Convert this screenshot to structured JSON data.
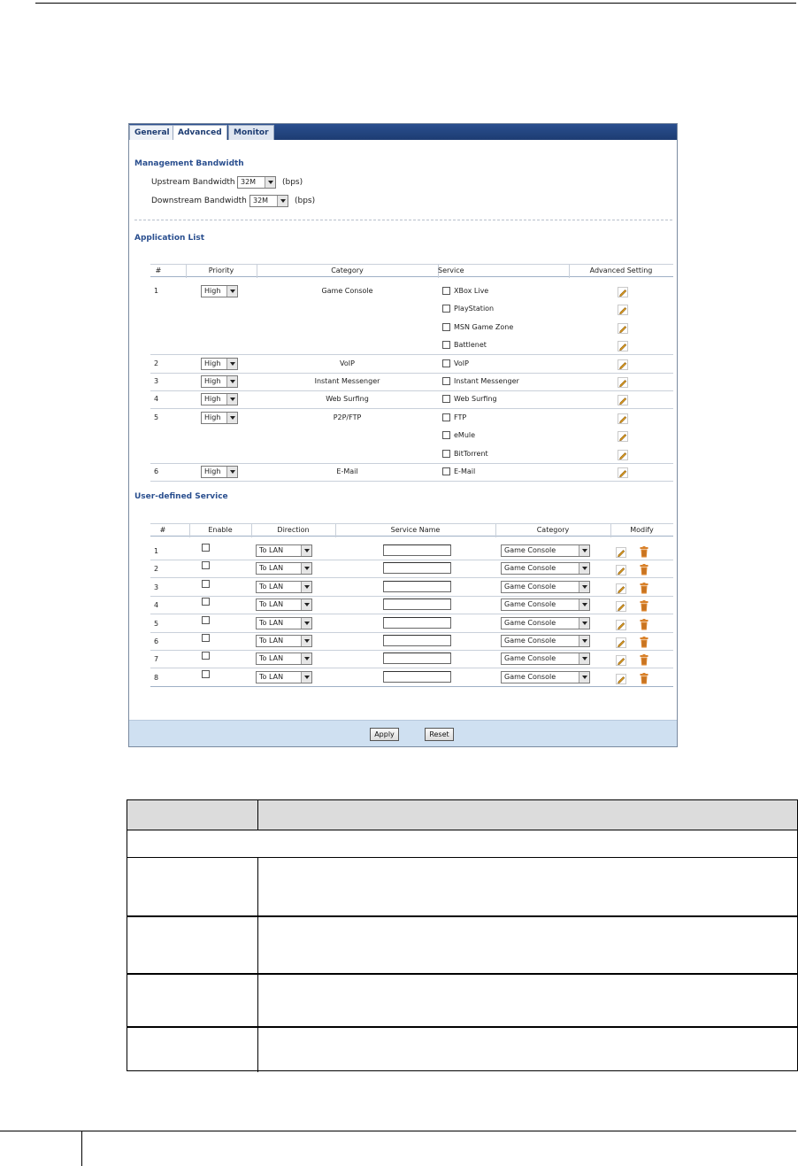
{
  "tabs": [
    {
      "label": "General"
    },
    {
      "label": "Advanced"
    },
    {
      "label": "Monitor"
    }
  ],
  "management": {
    "title": "Management Bandwidth",
    "upstream_label": "Upstream Bandwidth",
    "upstream_value": "32M",
    "upstream_unit": "(bps)",
    "downstream_label": "Downstream Bandwidth",
    "downstream_value": "32M",
    "downstream_unit": "(bps)"
  },
  "application_list": {
    "title": "Application List",
    "columns": [
      "#",
      "Priority",
      "Category",
      "Service",
      "Advanced Setting"
    ],
    "rows": [
      {
        "num": "1",
        "priority": "High",
        "category": "Game Console",
        "service": "XBox Live"
      },
      {
        "num": "",
        "priority": "",
        "category": "",
        "service": "PlayStation"
      },
      {
        "num": "",
        "priority": "",
        "category": "",
        "service": "MSN Game Zone"
      },
      {
        "num": "",
        "priority": "",
        "category": "",
        "service": "Battlenet"
      },
      {
        "num": "2",
        "priority": "High",
        "category": "VoIP",
        "service": "VoIP"
      },
      {
        "num": "3",
        "priority": "High",
        "category": "Instant Messenger",
        "service": "Instant Messenger"
      },
      {
        "num": "4",
        "priority": "High",
        "category": "Web Surfing",
        "service": "Web Surfing"
      },
      {
        "num": "5",
        "priority": "High",
        "category": "P2P/FTP",
        "service": "FTP"
      },
      {
        "num": "",
        "priority": "",
        "category": "",
        "service": "eMule"
      },
      {
        "num": "",
        "priority": "",
        "category": "",
        "service": "BitTorrent"
      },
      {
        "num": "6",
        "priority": "High",
        "category": "E-Mail",
        "service": "E-Mail"
      }
    ]
  },
  "user_defined": {
    "title": "User-defined Service",
    "columns": [
      "#",
      "Enable",
      "Direction",
      "Service Name",
      "Category",
      "Modify"
    ],
    "rows": [
      {
        "num": "1",
        "direction": "To LAN",
        "category": "Game Console"
      },
      {
        "num": "2",
        "direction": "To LAN",
        "category": "Game Console"
      },
      {
        "num": "3",
        "direction": "To LAN",
        "category": "Game Console"
      },
      {
        "num": "4",
        "direction": "To LAN",
        "category": "Game Console"
      },
      {
        "num": "5",
        "direction": "To LAN",
        "category": "Game Console"
      },
      {
        "num": "6",
        "direction": "To LAN",
        "category": "Game Console"
      },
      {
        "num": "7",
        "direction": "To LAN",
        "category": "Game Console"
      },
      {
        "num": "8",
        "direction": "To LAN",
        "category": "Game Console"
      }
    ]
  },
  "buttons": {
    "apply": "Apply",
    "reset": "Reset"
  },
  "colors": {
    "tabbar": "#1d3c72",
    "section_title": "#2a4f8f",
    "button_bar": "#cfe0f1",
    "edit_icon": "#e0a020",
    "trash_icon": "#d9822b"
  }
}
